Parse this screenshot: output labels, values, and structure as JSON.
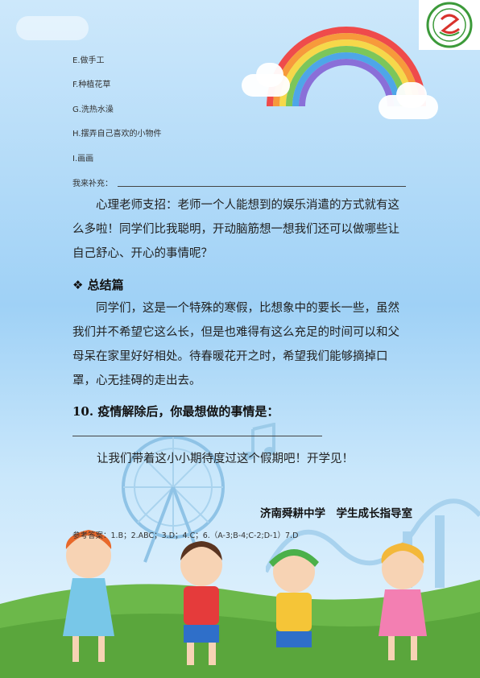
{
  "options": [
    "E.做手工",
    "F.种植花草",
    "G.洗热水澡",
    "H.摆弄自己喜欢的小物件",
    "I.画画"
  ],
  "supplement_label": "我来补充：",
  "tip_paragraph": "心理老师支招：老师一个人能想到的娱乐消遣的方式就有这么多啦！同学们比我聪明，开动脑筋想一想我们还可以做哪些让自己舒心、开心的事情呢？",
  "summary_heading": "❖ 总结篇",
  "summary_paragraph": "同学们，这是一个特殊的寒假，比想象中的要长一些，虽然我们并不希望它这么长，但是也难得有这么充足的时间可以和父母呆在家里好好相处。待春暖花开之时，希望我们能够摘掉口罩，心无挂碍的走出去。",
  "question_10": "10. 疫情解除后，你最想做的事情是：",
  "closing_line": "让我们带着这小小期待度过这个假期吧！开学见！",
  "signature": "济南舜耕中学　学生成长指导室",
  "answer_key": "参考答案：1.B；2.ABC；3.D；4.C；6.（A-3;B-4;C-2;D-1）7.D",
  "colors": {
    "sky_top": "#cde8fb",
    "sky_mid": "#9fd1f6",
    "grass": "#6cb84a",
    "logo_green": "#3c9a3a",
    "logo_red": "#d8322c"
  }
}
